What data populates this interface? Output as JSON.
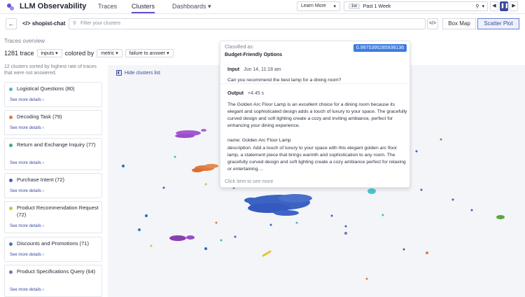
{
  "header": {
    "app_title": "LLM Observability",
    "tabs": [
      {
        "label": "Traces"
      },
      {
        "label": "Clusters"
      },
      {
        "label": "Dashboards"
      }
    ],
    "learn_more": "Learn More",
    "time_badge": "1w",
    "time_range": "Past 1 Week"
  },
  "toolbar": {
    "app_name": "shopist-chat",
    "filter_placeholder": "Filter your clusters",
    "view_box_map": "Box Map",
    "view_scatter": "Scatter Plot"
  },
  "sidebar": {
    "section_label": "Traces overview",
    "trace_count": "1281 trace",
    "group_dropdown": "inputs",
    "colored_by_label": "colored by",
    "metric_dropdown": "metric",
    "metric_value_dropdown": "failure to answer",
    "description": "12 clusters sorted by highest rate of traces that were not answered.",
    "see_more": "See more details",
    "clusters": [
      {
        "name": "Logistical Questions (80)",
        "color": "#4bb8c9"
      },
      {
        "name": "Decoding Task (79)",
        "color": "#e07a3d"
      },
      {
        "name": "Return and Exchange Inquiry (77)",
        "color": "#3fa88a"
      },
      {
        "name": "Purchase Intent (72)",
        "color": "#3a63c4"
      },
      {
        "name": "Product Recommendation Request (72)",
        "color": "#c8c83a"
      },
      {
        "name": "Discounts and Promotions (71)",
        "color": "#3d7ab8"
      },
      {
        "name": "Product Specifications Query (64)",
        "color": "#8a6ab8"
      }
    ]
  },
  "plot": {
    "hide_label": "Hide clusters list"
  },
  "tooltip": {
    "classified_label": "Classified as:",
    "classified_name": "Budget-Friendly Options",
    "score": "0.9975395285938136",
    "input_label": "Input",
    "input_time": "Jun 14, 11:18 am",
    "input_text": "Can you recommend the best lamp for a dining room?",
    "output_label": "Output",
    "output_time": "+4.45 s",
    "output_p1": "The Golden Arc Floor Lamp is an excellent choice for a dining room because its elegant and sophisticated design adds a touch of luxury to your space. The gracefully curved design and soft lighting create a cozy and inviting ambiance, perfect for enhancing your dining experience.",
    "output_p2": "name: Golden Arc Floor Lamp",
    "output_p3": "description: Add a touch of luxury to your space with this elegant golden arc floor lamp, a statement piece that brings warmth and sophistication to any room. The gracefully curved design and soft lighting create a cozy ambiance perfect for relaxing or entertaining....",
    "footer": "Click item to see more"
  }
}
